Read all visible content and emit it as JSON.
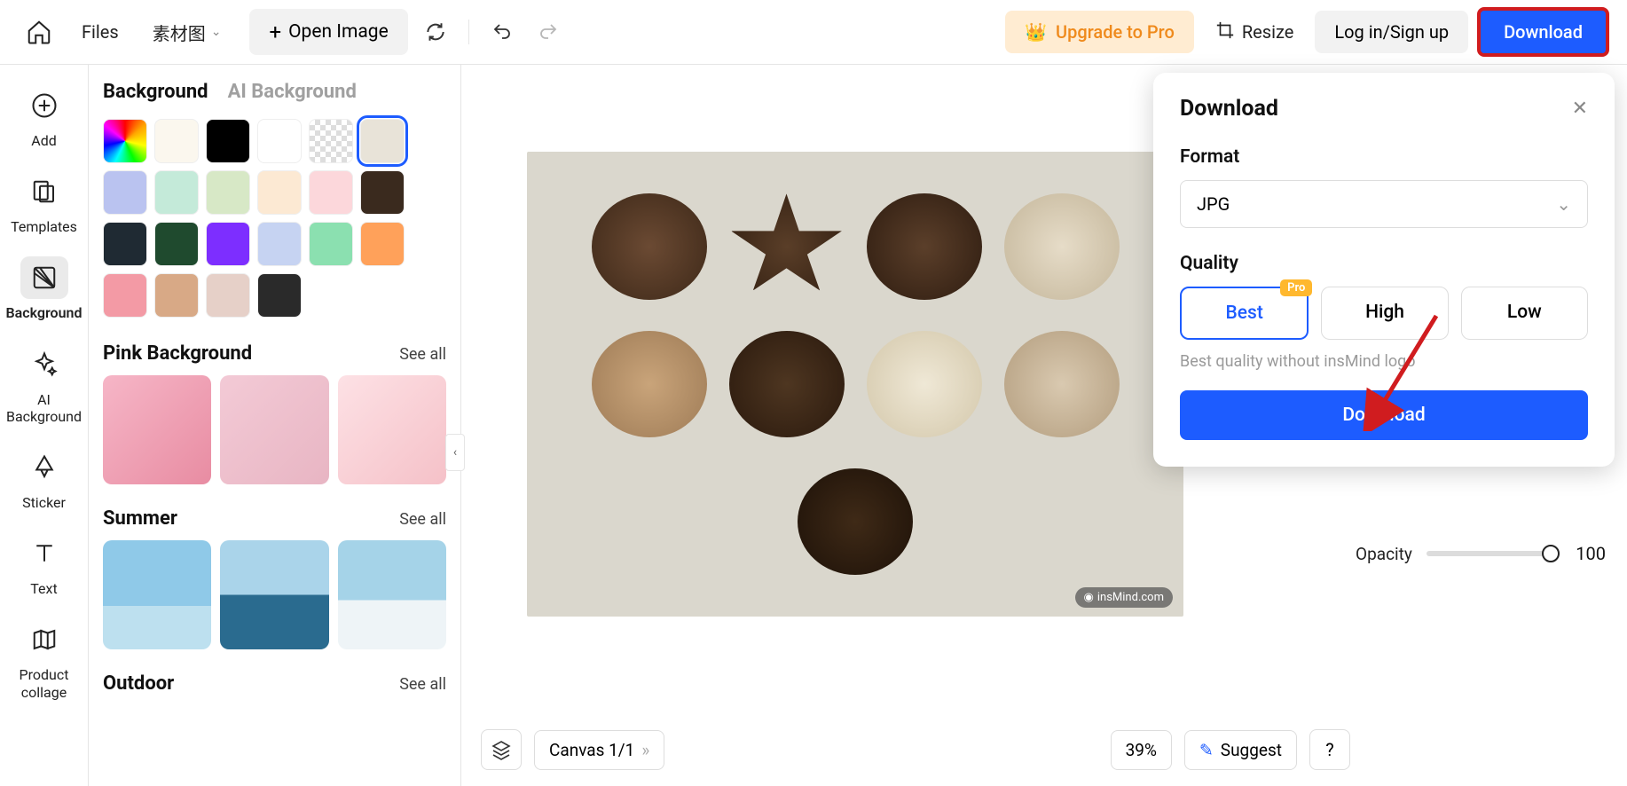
{
  "toolbar": {
    "files": "Files",
    "material": "素材图",
    "open_image": "Open Image",
    "upgrade": "Upgrade to Pro",
    "resize": "Resize",
    "login": "Log in/Sign up",
    "download": "Download"
  },
  "rail": {
    "add": "Add",
    "templates": "Templates",
    "background": "Background",
    "ai_background": "AI\nBackground",
    "sticker": "Sticker",
    "text": "Text",
    "product_collage": "Product\ncollage"
  },
  "panel": {
    "tab_background": "Background",
    "tab_ai": "AI Background",
    "swatches": [
      {
        "style": "rainbow"
      },
      {
        "color": "#fbf7ee"
      },
      {
        "color": "#000000"
      },
      {
        "color": "#ffffff"
      },
      {
        "style": "checker"
      },
      {
        "color": "#e8e3d8",
        "selected": true
      },
      {
        "color": "#bac3f0"
      },
      {
        "color": "#c4ead9"
      },
      {
        "color": "#d7e8c6"
      },
      {
        "color": "#fce9d3"
      },
      {
        "color": "#fcd7db"
      },
      {
        "color": "#3a2a1e"
      },
      {
        "color": "#1f2a33"
      },
      {
        "color": "#1f4a2e"
      },
      {
        "color": "#7d2eff"
      },
      {
        "color": "#c6d3f2"
      },
      {
        "color": "#8be0b0"
      },
      {
        "color": "#ffa15a"
      },
      {
        "color": "#f39aa5"
      },
      {
        "color": "#d8a986"
      },
      {
        "color": "#e6d0c8"
      },
      {
        "color": "#2a2a2a"
      }
    ],
    "sections": [
      {
        "title": "Pink Background",
        "see_all": "See all",
        "thumbs": [
          "pink1",
          "pink2",
          "pink3"
        ]
      },
      {
        "title": "Summer",
        "see_all": "See all",
        "thumbs": [
          "summer1",
          "summer2",
          "summer3"
        ]
      },
      {
        "title": "Outdoor",
        "see_all": "See all",
        "thumbs": []
      }
    ]
  },
  "canvas": {
    "watermark": "insMind.com",
    "canvas_label": "Canvas 1/1",
    "zoom": "39%",
    "suggest": "Suggest",
    "help": "?"
  },
  "right": {
    "opacity_label": "Opacity",
    "opacity_value": "100"
  },
  "download_popover": {
    "title": "Download",
    "format_label": "Format",
    "format_value": "JPG",
    "quality_label": "Quality",
    "quality_options": [
      "Best",
      "High",
      "Low"
    ],
    "quality_selected": "Best",
    "pro_badge": "Pro",
    "note": "Best quality without insMind logo",
    "action": "Download"
  }
}
